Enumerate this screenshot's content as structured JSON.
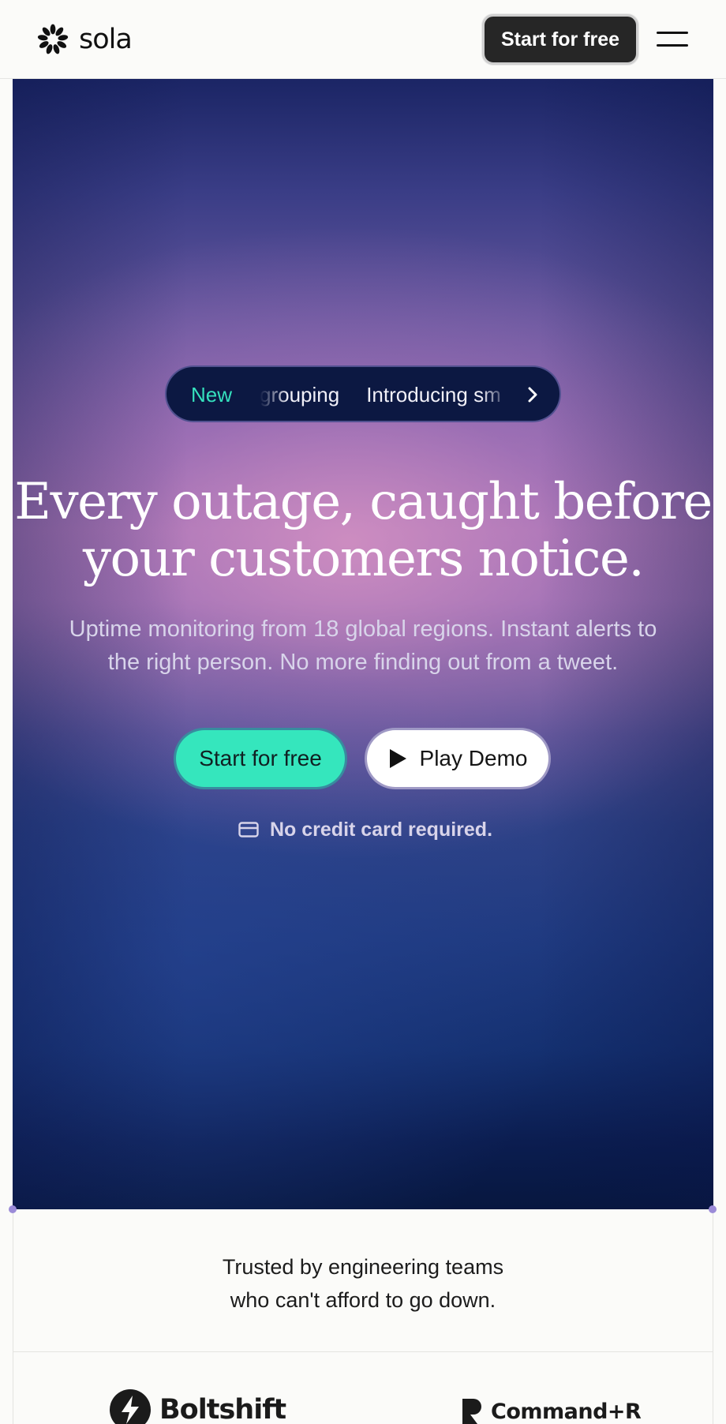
{
  "header": {
    "brand": "sola",
    "cta_label": "Start for free",
    "menu_icon": "hamburger-icon"
  },
  "hero": {
    "announcement": {
      "badge": "New",
      "ticker_items": [
        "grouping",
        "Introducing sm"
      ]
    },
    "headline": "Every outage, caught before your customers notice.",
    "subheadline": "Uptime monitoring from 18 global regions. Instant alerts to the right person. No more finding out from a tweet.",
    "primary_cta": "Start for free",
    "secondary_cta": "Play Demo",
    "no_card_note": "No credit card required."
  },
  "trusted": {
    "line1": "Trusted by engineering teams",
    "line2": "who can't afford to go down.",
    "logos": [
      "Boltshift",
      "Command+R"
    ]
  },
  "colors": {
    "accent": "#35e6bd",
    "header_button": "#262626",
    "announce_bg": "#0c1842",
    "hero_top": "#1b2565",
    "hero_glow": "#a877b4",
    "hero_bottom": "#07173f"
  }
}
